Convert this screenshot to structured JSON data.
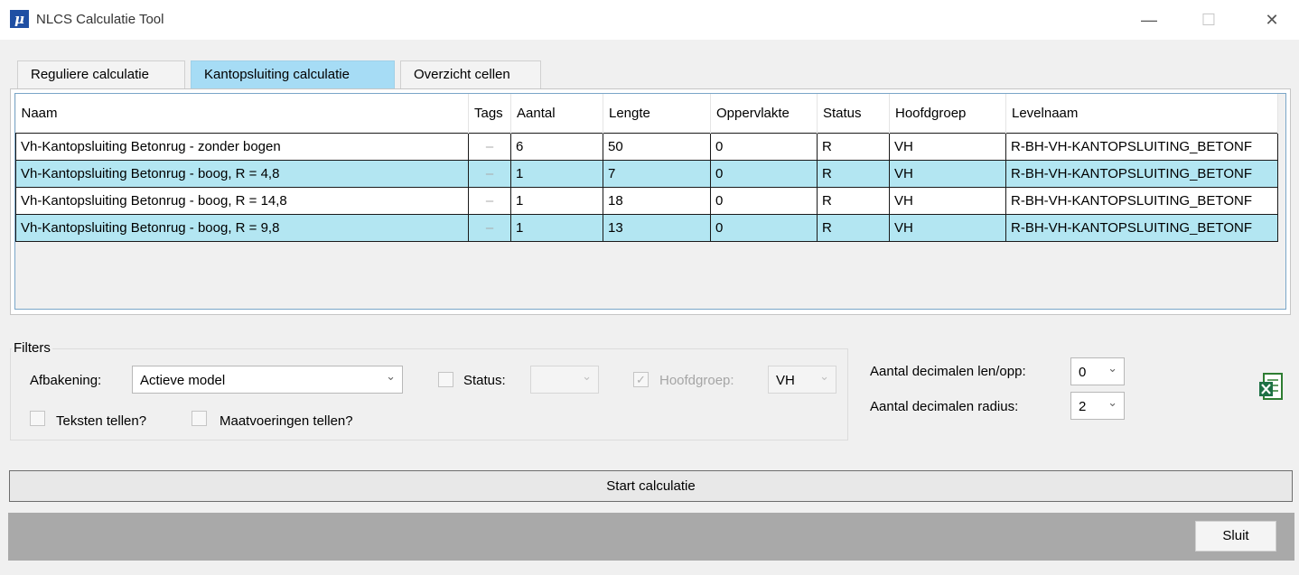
{
  "window": {
    "title": "NLCS Calculatie Tool",
    "icon_glyph": "μ",
    "minimize_glyph": "—",
    "maximize_glyph": "☐",
    "close_glyph": "✕"
  },
  "tabs": [
    {
      "label": "Reguliere calculatie",
      "active": false
    },
    {
      "label": "Kantopsluiting calculatie",
      "active": true
    },
    {
      "label": "Overzicht cellen",
      "active": false
    }
  ],
  "table": {
    "columns": [
      "Naam",
      "Tags",
      "Aantal",
      "Lengte",
      "Oppervlakte",
      "Status",
      "Hoofdgroep",
      "Levelnaam"
    ],
    "rows": [
      {
        "naam": "Vh-Kantopsluiting Betonrug - zonder bogen",
        "tags": "–",
        "aantal": "6",
        "lengte": "50",
        "oppervlakte": "0",
        "status": "R",
        "hoofdgroep": "VH",
        "levelnaam": "R-BH-VH-KANTOPSLUITING_BETONF"
      },
      {
        "naam": "Vh-Kantopsluiting Betonrug - boog, R = 4,8",
        "tags": "–",
        "aantal": "1",
        "lengte": "7",
        "oppervlakte": "0",
        "status": "R",
        "hoofdgroep": "VH",
        "levelnaam": "R-BH-VH-KANTOPSLUITING_BETONF"
      },
      {
        "naam": "Vh-Kantopsluiting Betonrug - boog, R = 14,8",
        "tags": "–",
        "aantal": "1",
        "lengte": "18",
        "oppervlakte": "0",
        "status": "R",
        "hoofdgroep": "VH",
        "levelnaam": "R-BH-VH-KANTOPSLUITING_BETONF"
      },
      {
        "naam": "Vh-Kantopsluiting Betonrug - boog, R = 9,8",
        "tags": "–",
        "aantal": "1",
        "lengte": "13",
        "oppervlakte": "0",
        "status": "R",
        "hoofdgroep": "VH",
        "levelnaam": "R-BH-VH-KANTOPSLUITING_BETONF"
      }
    ],
    "highlight_color": "#b3e6f2"
  },
  "filters": {
    "legend": "Filters",
    "afbakening_label": "Afbakening:",
    "afbakening_value": "Actieve model",
    "status_label": "Status:",
    "status_value": "",
    "hoofdgroep_label": "Hoofdgroep:",
    "hoofdgroep_value": "VH",
    "teksten_label": "Teksten tellen?",
    "maatvoeringen_label": "Maatvoeringen tellen?"
  },
  "decimals": {
    "len_opp_label": "Aantal decimalen len/opp:",
    "len_opp_value": "0",
    "radius_label": "Aantal decimalen radius:",
    "radius_value": "2"
  },
  "actions": {
    "start_label": "Start calculatie",
    "close_label": "Sluit",
    "export_icon": "excel-export-icon"
  },
  "colors": {
    "active_tab": "#a6dcf5",
    "bottom_bar": "#a9a9a9"
  }
}
